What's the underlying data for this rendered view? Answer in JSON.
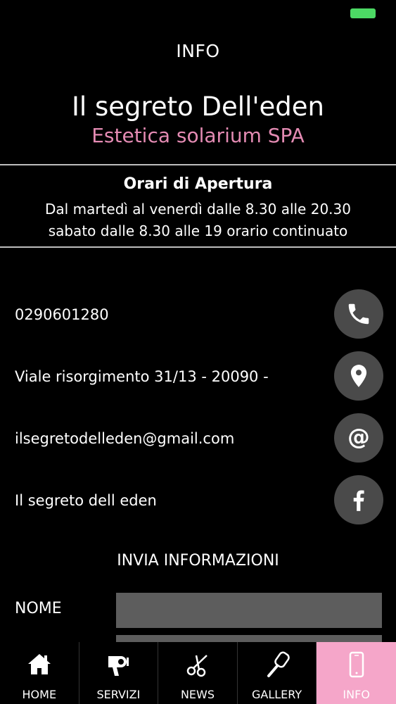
{
  "header": {
    "title": "INFO"
  },
  "brand": {
    "name": "Il segreto Dell'eden",
    "subtitle": "Estetica solarium SPA",
    "subtitle_color": "#e48bb3"
  },
  "hours": {
    "title": "Orari di Apertura",
    "lines": [
      "Dal martedì al venerdì dalle 8.30 alle 20.30",
      "sabato dalle 8.30 alle 19 orario continuato"
    ]
  },
  "contacts": [
    {
      "text": "0290601280",
      "icon": "phone-icon"
    },
    {
      "text": "Viale risorgimento 31/13 - 20090 -",
      "icon": "map-pin-icon"
    },
    {
      "text": "ilsegretodelleden@gmail.com",
      "icon": "at-icon"
    },
    {
      "text": "Il segreto dell eden",
      "icon": "facebook-icon"
    }
  ],
  "form": {
    "title": "INVIA INFORMAZIONI",
    "fields": [
      {
        "label": "NOME",
        "value": ""
      }
    ]
  },
  "tabbar": {
    "active_color": "#f5a6c9",
    "tabs": [
      {
        "label": "HOME",
        "icon": "home-icon"
      },
      {
        "label": "SERVIZI",
        "icon": "hairdryer-icon"
      },
      {
        "label": "NEWS",
        "icon": "scissors-icon"
      },
      {
        "label": "GALLERY",
        "icon": "brush-icon"
      },
      {
        "label": "INFO",
        "icon": "phone-device-icon",
        "active": true
      }
    ]
  }
}
